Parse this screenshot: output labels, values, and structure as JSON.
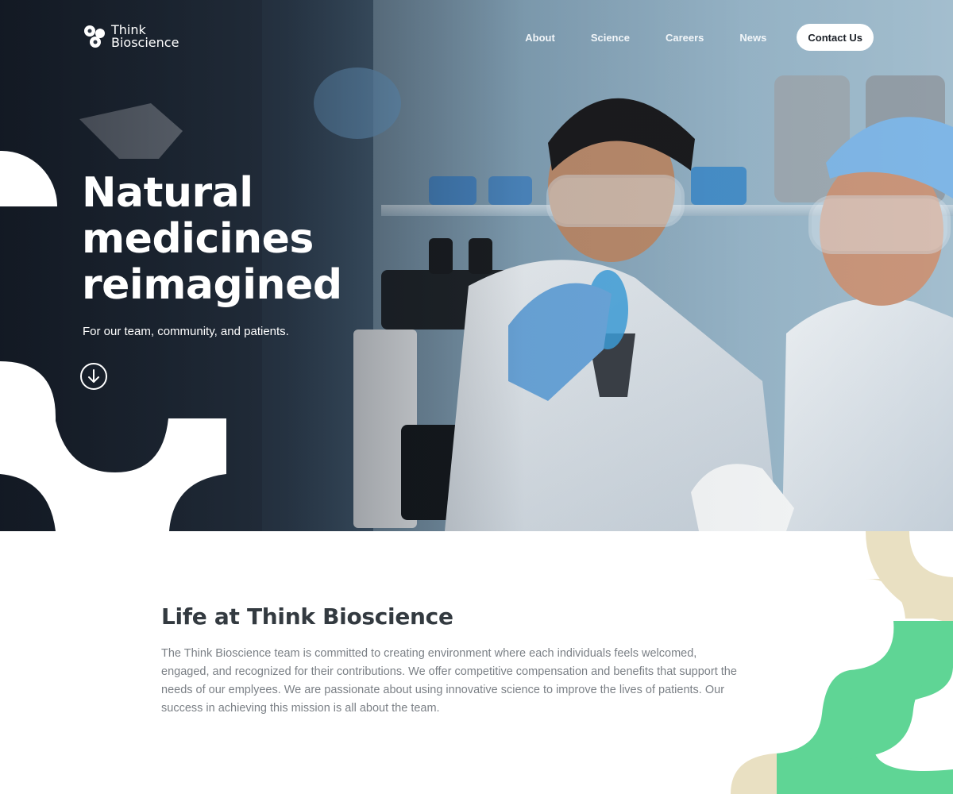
{
  "logo": {
    "line1": "Think",
    "line2": "Bioscience",
    "icon": "molecule-logo-icon"
  },
  "nav": {
    "links": [
      "About",
      "Science",
      "Careers",
      "News"
    ],
    "cta": "Contact Us"
  },
  "hero": {
    "title_line1": "Natural",
    "title_line2": "medicines",
    "title_line3": "reimagined",
    "subtitle": "For our team, community, and patients.",
    "scroll_icon": "arrow-down-circle-icon"
  },
  "section": {
    "title": "Life at Think Bioscience",
    "body": "The Think Bioscience team is committed to creating environment where each individuals feels welcomed, engaged, and recognized for their contributions. We offer competitive compensation and benefits that support the needs of our emplyees. We are passionate about using innovative science to improve the lives of patients. Our success in achieving this mission is all about the team."
  },
  "colors": {
    "green": "#5fd595",
    "beige": "#e9e0c2",
    "text_dark": "#333a40",
    "text_body": "#7b8086"
  }
}
